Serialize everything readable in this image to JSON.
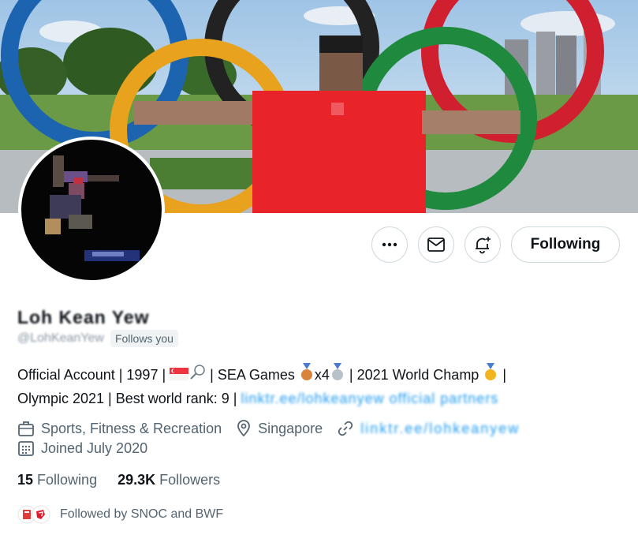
{
  "profile": {
    "display_name": "Loh Kean Yew",
    "handle": "@LohKeanYew",
    "follows_you": "Follows you",
    "bio_part1": "Official Account | 1997 | ",
    "bio_part2": " | SEA Games ",
    "bio_part3": "x4",
    "bio_part4": " | 2021 World Champ ",
    "bio_part5": " |",
    "bio_part6": "Olympic 2021 | Best world rank: 9 |",
    "bio_link": "linktr.ee/lohkeanyew official partners",
    "category": "Sports, Fitness & Recreation",
    "location": "Singapore",
    "website": "linktr.ee/lohkeanyew",
    "joined": "Joined July 2020"
  },
  "stats": {
    "following_count": "15",
    "following_label": "Following",
    "followers_count": "29.3K",
    "followers_label": "Followers"
  },
  "followed_by": "Followed by SNOC and BWF",
  "actions": {
    "more": "more-options",
    "message": "message",
    "notify": "notifications",
    "following_label": "Following"
  },
  "colors": {
    "accent": "#1d9bf0",
    "secondary_text": "#536471",
    "border": "#cfd9de"
  }
}
